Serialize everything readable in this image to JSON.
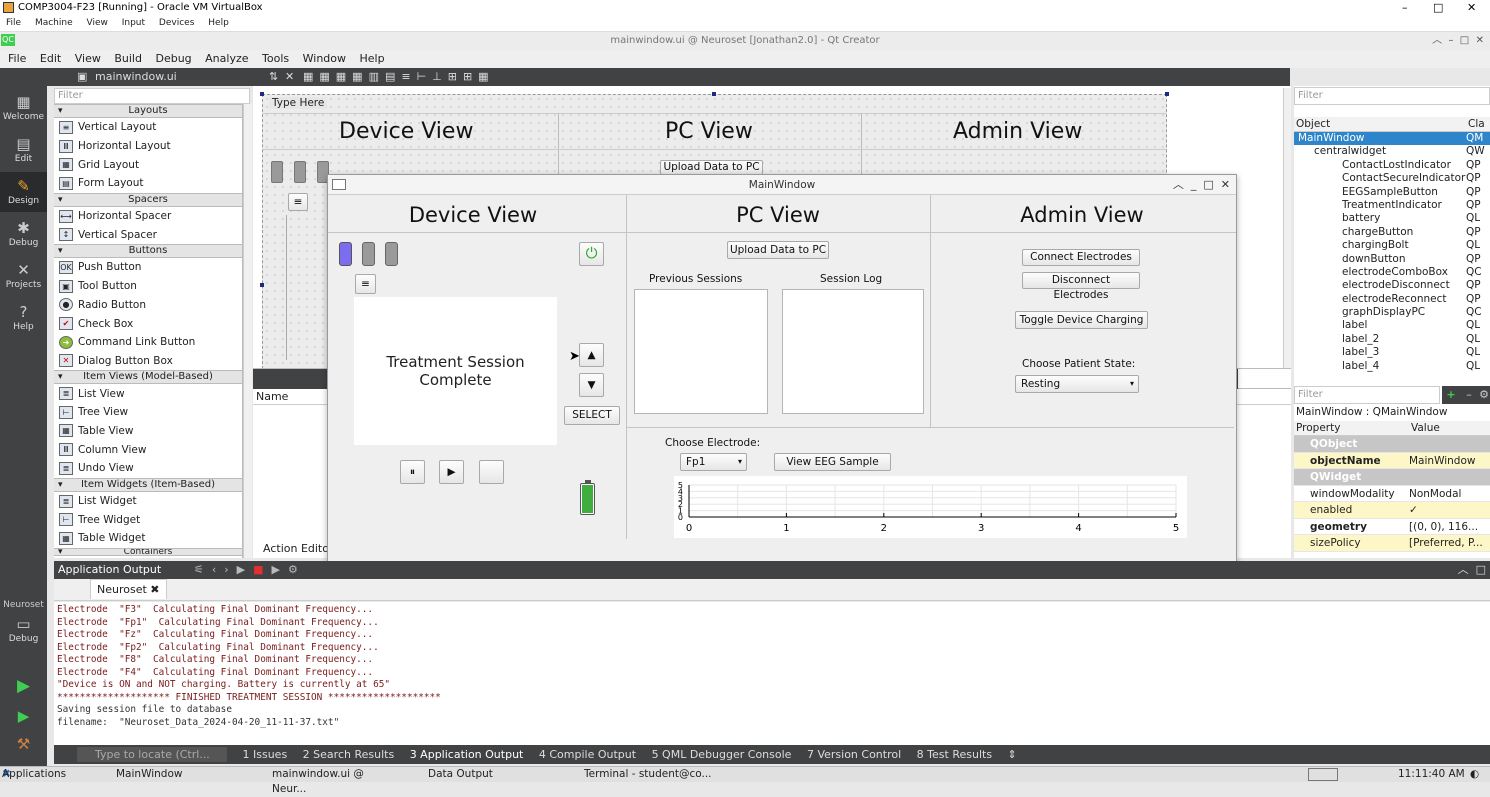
{
  "vbox": {
    "title": "COMP3004-F23 [Running] - Oracle VM VirtualBox",
    "menu": [
      "File",
      "Machine",
      "View",
      "Input",
      "Devices",
      "Help"
    ]
  },
  "qtcreator": {
    "title": "mainwindow.ui @ Neuroset [Jonathan2.0] - Qt Creator",
    "menu": [
      "File",
      "Edit",
      "View",
      "Build",
      "Debug",
      "Analyze",
      "Tools",
      "Window",
      "Help"
    ],
    "open_file": "mainwindow.ui",
    "modes": [
      "Welcome",
      "Edit",
      "Design",
      "Debug",
      "Projects",
      "Help"
    ],
    "kit_project": "Neuroset",
    "kit_mode": "Debug"
  },
  "widget_box": {
    "filter_placeholder": "Filter",
    "categories": {
      "layouts": "Layouts",
      "spacers": "Spacers",
      "buttons": "Buttons",
      "item_views": "Item Views (Model-Based)",
      "item_widgets": "Item Widgets (Item-Based)",
      "containers": "Containers"
    },
    "layouts": [
      "Vertical Layout",
      "Horizontal Layout",
      "Grid Layout",
      "Form Layout"
    ],
    "spacers": [
      "Horizontal Spacer",
      "Vertical Spacer"
    ],
    "buttons": [
      "Push Button",
      "Tool Button",
      "Radio Button",
      "Check Box",
      "Command Link Button",
      "Dialog Button Box"
    ],
    "item_views": [
      "List View",
      "Tree View",
      "Table View",
      "Column View",
      "Undo View"
    ],
    "item_widgets": [
      "List Widget",
      "Tree Widget",
      "Table Widget"
    ]
  },
  "design_form": {
    "menu_placeholder": "Type Here",
    "device_view": "Device View",
    "pc_view": "PC View",
    "admin_view": "Admin View",
    "upload_button": "Upload Data to PC",
    "action_editor_col": "Name",
    "action_editor_tab": "Action Editor"
  },
  "object_inspector": {
    "filter_placeholder": "Filter",
    "col_object": "Object",
    "col_class": "Cla",
    "rows": [
      {
        "name": "MainWindow",
        "cls": "QM"
      },
      {
        "name": "centralwidget",
        "cls": "QW"
      },
      {
        "name": "ContactLostIndicator",
        "cls": "QP"
      },
      {
        "name": "ContactSecureIndicator",
        "cls": "QP"
      },
      {
        "name": "EEGSampleButton",
        "cls": "QP"
      },
      {
        "name": "TreatmentIndicator",
        "cls": "QP"
      },
      {
        "name": "battery",
        "cls": "QL"
      },
      {
        "name": "chargeButton",
        "cls": "QP"
      },
      {
        "name": "chargingBolt",
        "cls": "QL"
      },
      {
        "name": "downButton",
        "cls": "QP"
      },
      {
        "name": "electrodeComboBox",
        "cls": "QC"
      },
      {
        "name": "electrodeDisconnect",
        "cls": "QP"
      },
      {
        "name": "electrodeReconnect",
        "cls": "QP"
      },
      {
        "name": "graphDisplayPC",
        "cls": "QC"
      },
      {
        "name": "label",
        "cls": "QL"
      },
      {
        "name": "label_2",
        "cls": "QL"
      },
      {
        "name": "label_3",
        "cls": "QL"
      },
      {
        "name": "label_4",
        "cls": "QL"
      }
    ]
  },
  "property_editor": {
    "filter_placeholder": "Filter",
    "context": "MainWindow : QMainWindow",
    "col_property": "Property",
    "col_value": "Value",
    "group_qobject": "QObject",
    "group_qwidget": "QWidget",
    "rows": [
      {
        "k": "objectName",
        "v": "MainWindow"
      },
      {
        "k": "windowModality",
        "v": "NonModal"
      },
      {
        "k": "enabled",
        "v": "✓"
      },
      {
        "k": "geometry",
        "v": "[(0, 0), 116..."
      },
      {
        "k": "sizePolicy",
        "v": "[Preferred, P..."
      }
    ]
  },
  "app": {
    "title": "MainWindow",
    "device_view": "Device View",
    "pc_view": "PC View",
    "admin_view": "Admin View",
    "screen_text": "Treatment Session Complete",
    "menu_icon": "≡",
    "select_button": "SELECT",
    "upload_button": "Upload Data to PC",
    "previous_sessions": "Previous Sessions",
    "session_log": "Session Log",
    "connect_electrodes": "Connect Electrodes",
    "disconnect_electrodes": "Disconnect Electrodes",
    "toggle_charging": "Toggle Device Charging",
    "patient_state_label": "Choose Patient State:",
    "patient_state_value": "Resting",
    "electrode_label": "Choose Electrode:",
    "electrode_value": "Fp1",
    "view_eeg": "View EEG Sample",
    "indicator_color_active": "#7b6cf0",
    "battery_color": "#3fae3f",
    "battery_level": 1.0
  },
  "chart_data": {
    "type": "line",
    "x_ticks": [
      "0",
      "1",
      "2",
      "3",
      "4",
      "5"
    ],
    "y_ticks": [
      "0",
      "1",
      "2",
      "3",
      "4",
      "5"
    ],
    "xlim": [
      0,
      5
    ],
    "ylim": [
      0,
      5
    ],
    "series": [],
    "grid": true
  },
  "output": {
    "header": "Application Output",
    "tab": "Neuroset",
    "lines": [
      "Electrode  \"F3\"  Calculating Final Dominant Frequency...",
      "Electrode  \"Fp1\"  Calculating Final Dominant Frequency...",
      "Electrode  \"Fz\"  Calculating Final Dominant Frequency...",
      "Electrode  \"Fp2\"  Calculating Final Dominant Frequency...",
      "Electrode  \"F8\"  Calculating Final Dominant Frequency...",
      "Electrode  \"F4\"  Calculating Final Dominant Frequency...",
      "\"Device is ON and NOT charging. Battery is currently at 65\"",
      "******************** FINISHED TREATMENT SESSION ********************",
      "Saving session file to database",
      "filename:  \"Neuroset_Data_2024-04-20_11-11-37.txt\""
    ]
  },
  "statusbar": {
    "locate_placeholder": "Type to locate (Ctrl...",
    "tabs": [
      "1 Issues",
      "2 Search Results",
      "3 Application Output",
      "4 Compile Output",
      "5 QML Debugger Console",
      "7 Version Control",
      "8 Test Results"
    ]
  },
  "taskbar": {
    "applications": "Applications",
    "items": [
      "MainWindow",
      "mainwindow.ui @ Neur...",
      "Data Output",
      "Terminal - student@co..."
    ],
    "clock": "11:11:40 AM"
  }
}
